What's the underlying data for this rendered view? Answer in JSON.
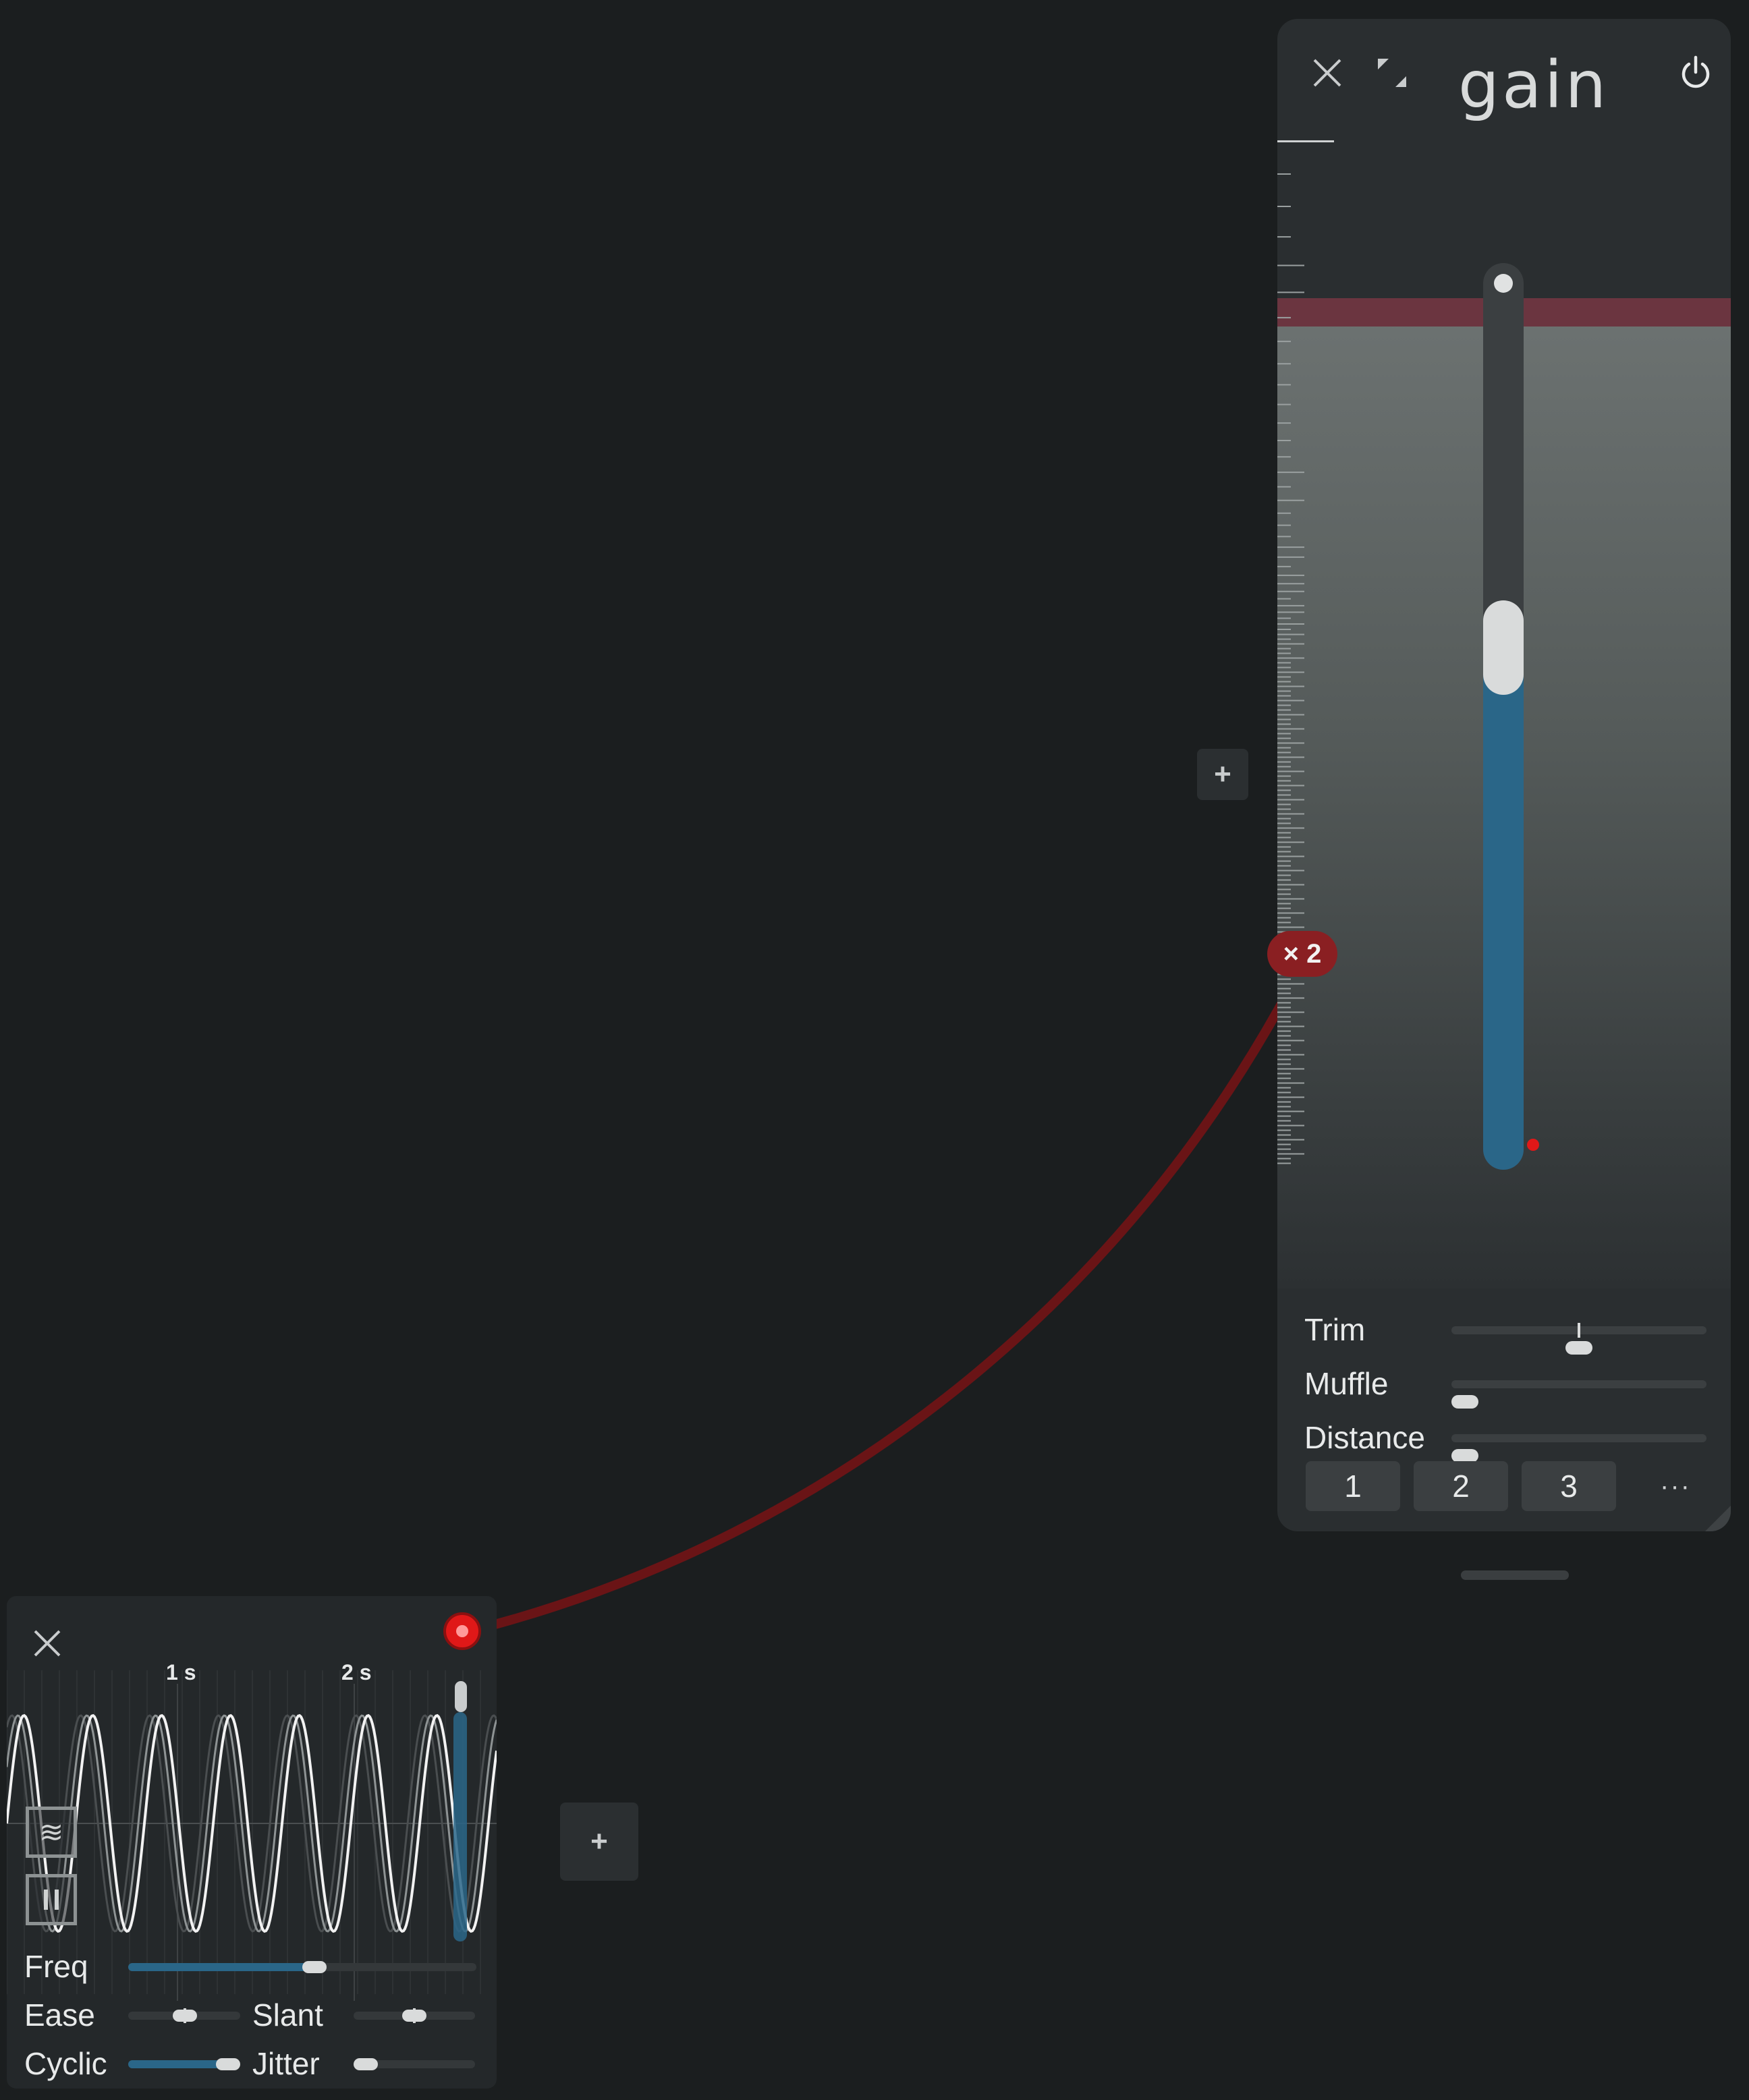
{
  "canvas": {
    "add_button_label": "+"
  },
  "gain_module": {
    "title": "gain",
    "close_icon": "close-icon",
    "expand_icon": "expand-icon",
    "power_icon": "power-icon",
    "fader_level": 0.61,
    "params": [
      {
        "label": "Trim",
        "value": 0.5,
        "bipolar": true
      },
      {
        "label": "Muffle",
        "value": 0.0,
        "bipolar": false
      },
      {
        "label": "Distance",
        "value": 0.0,
        "bipolar": false
      }
    ],
    "presets": [
      "1",
      "2",
      "3"
    ],
    "more_label": "···"
  },
  "modulation": {
    "multiplier_label": "× 2",
    "color": "#8a1f22"
  },
  "lfo_module": {
    "close_icon": "close-icon",
    "time_labels": [
      "1 s",
      "2 s"
    ],
    "wave_icon": "waves-icon",
    "pause_icon": "pause-icon",
    "params": {
      "freq": {
        "label": "Freq",
        "value": 0.52
      },
      "ease": {
        "label": "Ease",
        "value": 0.5
      },
      "slant": {
        "label": "Slant",
        "value": 0.5
      },
      "cyclic": {
        "label": "Cyclic",
        "value": 0.9
      },
      "jitter": {
        "label": "Jitter",
        "value": 0.0
      }
    }
  },
  "colors": {
    "accent_blue": "#2a6688",
    "mod_red": "#e01818",
    "background": "#1b1e1f"
  }
}
